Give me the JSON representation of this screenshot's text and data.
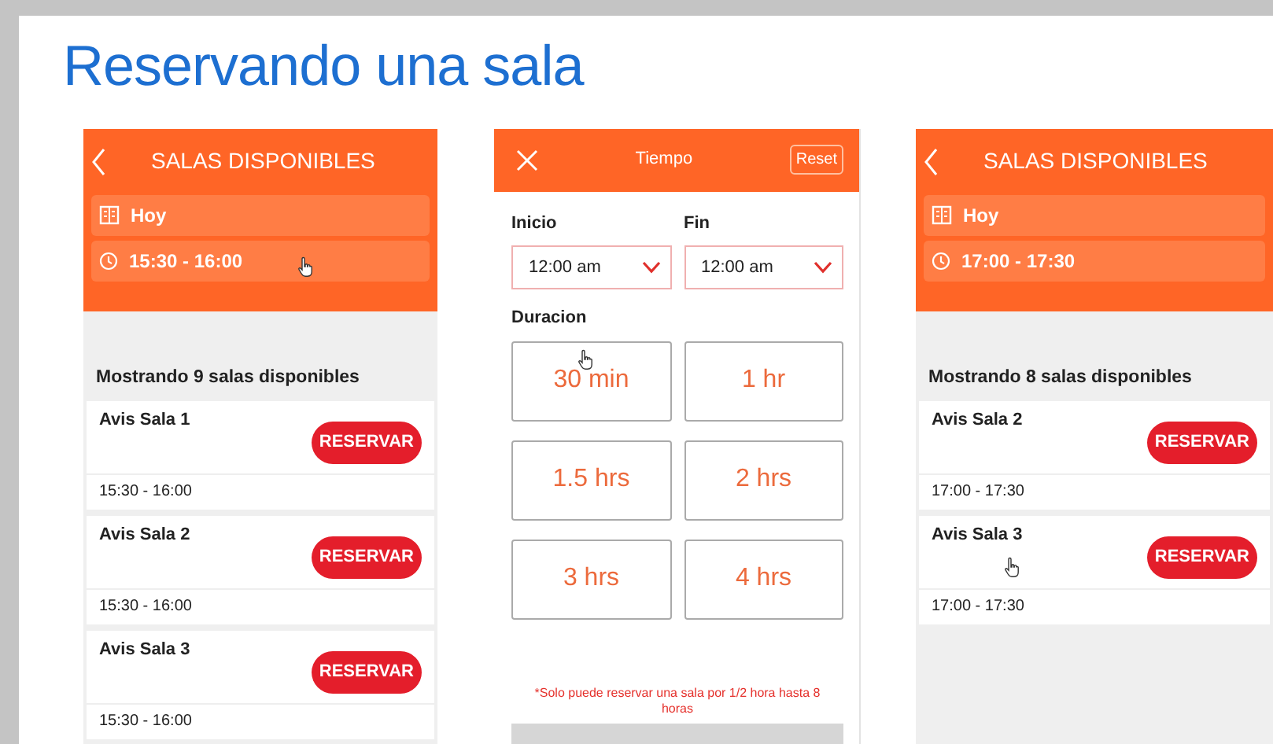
{
  "title": "Reservando una sala",
  "screens": [
    {
      "kind": "list",
      "header_title": "SALAS DISPONIBLES",
      "date": "Hoy",
      "time": "15:30 - 16:00",
      "time_pointer": true,
      "summary": "Mostrando 9 salas disponibles",
      "rooms": [
        {
          "name": "Avis Sala 1",
          "button": "RESERVAR",
          "time": "15:30 - 16:00",
          "pointer": false
        },
        {
          "name": "Avis Sala 2",
          "button": "RESERVAR",
          "time": "15:30 - 16:00",
          "pointer": false
        },
        {
          "name": "Avis Sala 3",
          "button": "RESERVAR",
          "time": "15:30 - 16:00",
          "pointer": false
        }
      ]
    },
    {
      "kind": "time",
      "header_title": "Tiempo",
      "reset": "Reset",
      "start_label": "Inicio",
      "start_value": "12:00 am",
      "end_label": "Fin",
      "end_value": "12:00 am",
      "duration_label": "Duracion",
      "durations": [
        {
          "label": "30 min",
          "pointer": true
        },
        {
          "label": "1 hr",
          "pointer": false
        },
        {
          "label": "1.5 hrs",
          "pointer": false
        },
        {
          "label": "2 hrs",
          "pointer": false
        },
        {
          "label": "3 hrs",
          "pointer": false
        },
        {
          "label": "4 hrs",
          "pointer": false
        }
      ],
      "note": "*Solo puede reservar una sala por 1/2 hora hasta 8 horas"
    },
    {
      "kind": "list",
      "header_title": "SALAS DISPONIBLES",
      "date": "Hoy",
      "time": "17:00 - 17:30",
      "time_pointer": false,
      "summary": "Mostrando 8 salas disponibles",
      "rooms": [
        {
          "name": "Avis Sala 2",
          "button": "RESERVAR",
          "time": "17:00 - 17:30",
          "pointer": false
        },
        {
          "name": "Avis Sala 3",
          "button": "RESERVAR",
          "time": "17:00 - 17:30",
          "pointer": true
        }
      ]
    }
  ]
}
